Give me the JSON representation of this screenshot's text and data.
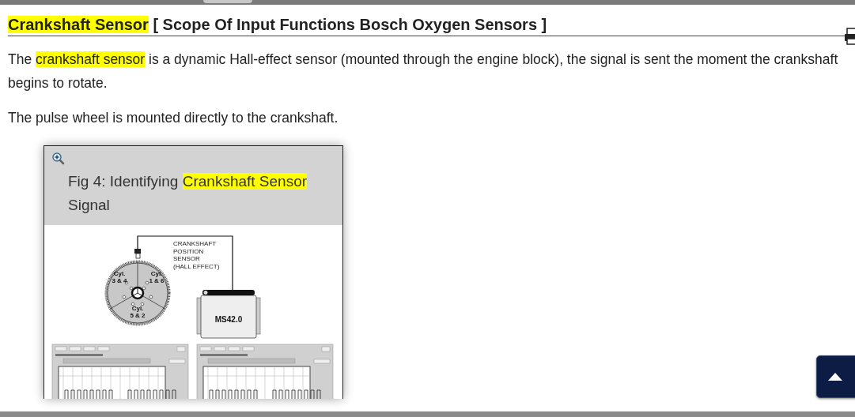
{
  "heading": {
    "highlight": "Crankshaft Sensor",
    "rest": "[ Scope Of Input Functions Bosch Oxygen Sensors ]"
  },
  "paragraphs": [
    {
      "segments": [
        {
          "text": "The ",
          "highlighted": false
        },
        {
          "text": "crankshaft sensor",
          "highlighted": true
        },
        {
          "text": " is a dynamic Hall-effect sensor (mounted through the engine block), the signal is sent the moment the crankshaft begins to rotate.",
          "highlighted": false
        }
      ]
    },
    {
      "segments": [
        {
          "text": "The pulse wheel is mounted directly to the crankshaft.",
          "highlighted": false
        }
      ]
    }
  ],
  "figure": {
    "caption": [
      {
        "text": "Fig 4: Identifying ",
        "highlighted": false
      },
      {
        "text": "Crankshaft Sensor",
        "highlighted": true
      },
      {
        "text": " Signal",
        "highlighted": false
      }
    ],
    "diagram": {
      "sensor_label": [
        "CRANKSHAFT",
        "POSITION",
        "SENSOR",
        "(HALL EFFECT)"
      ],
      "cylinder_labels": [
        [
          "Cyl.",
          "3 & 4"
        ],
        [
          "Cyl.",
          "1 & 6"
        ],
        [
          "Cyl.",
          "5 & 2"
        ]
      ],
      "module_label": "MS42.0"
    }
  }
}
